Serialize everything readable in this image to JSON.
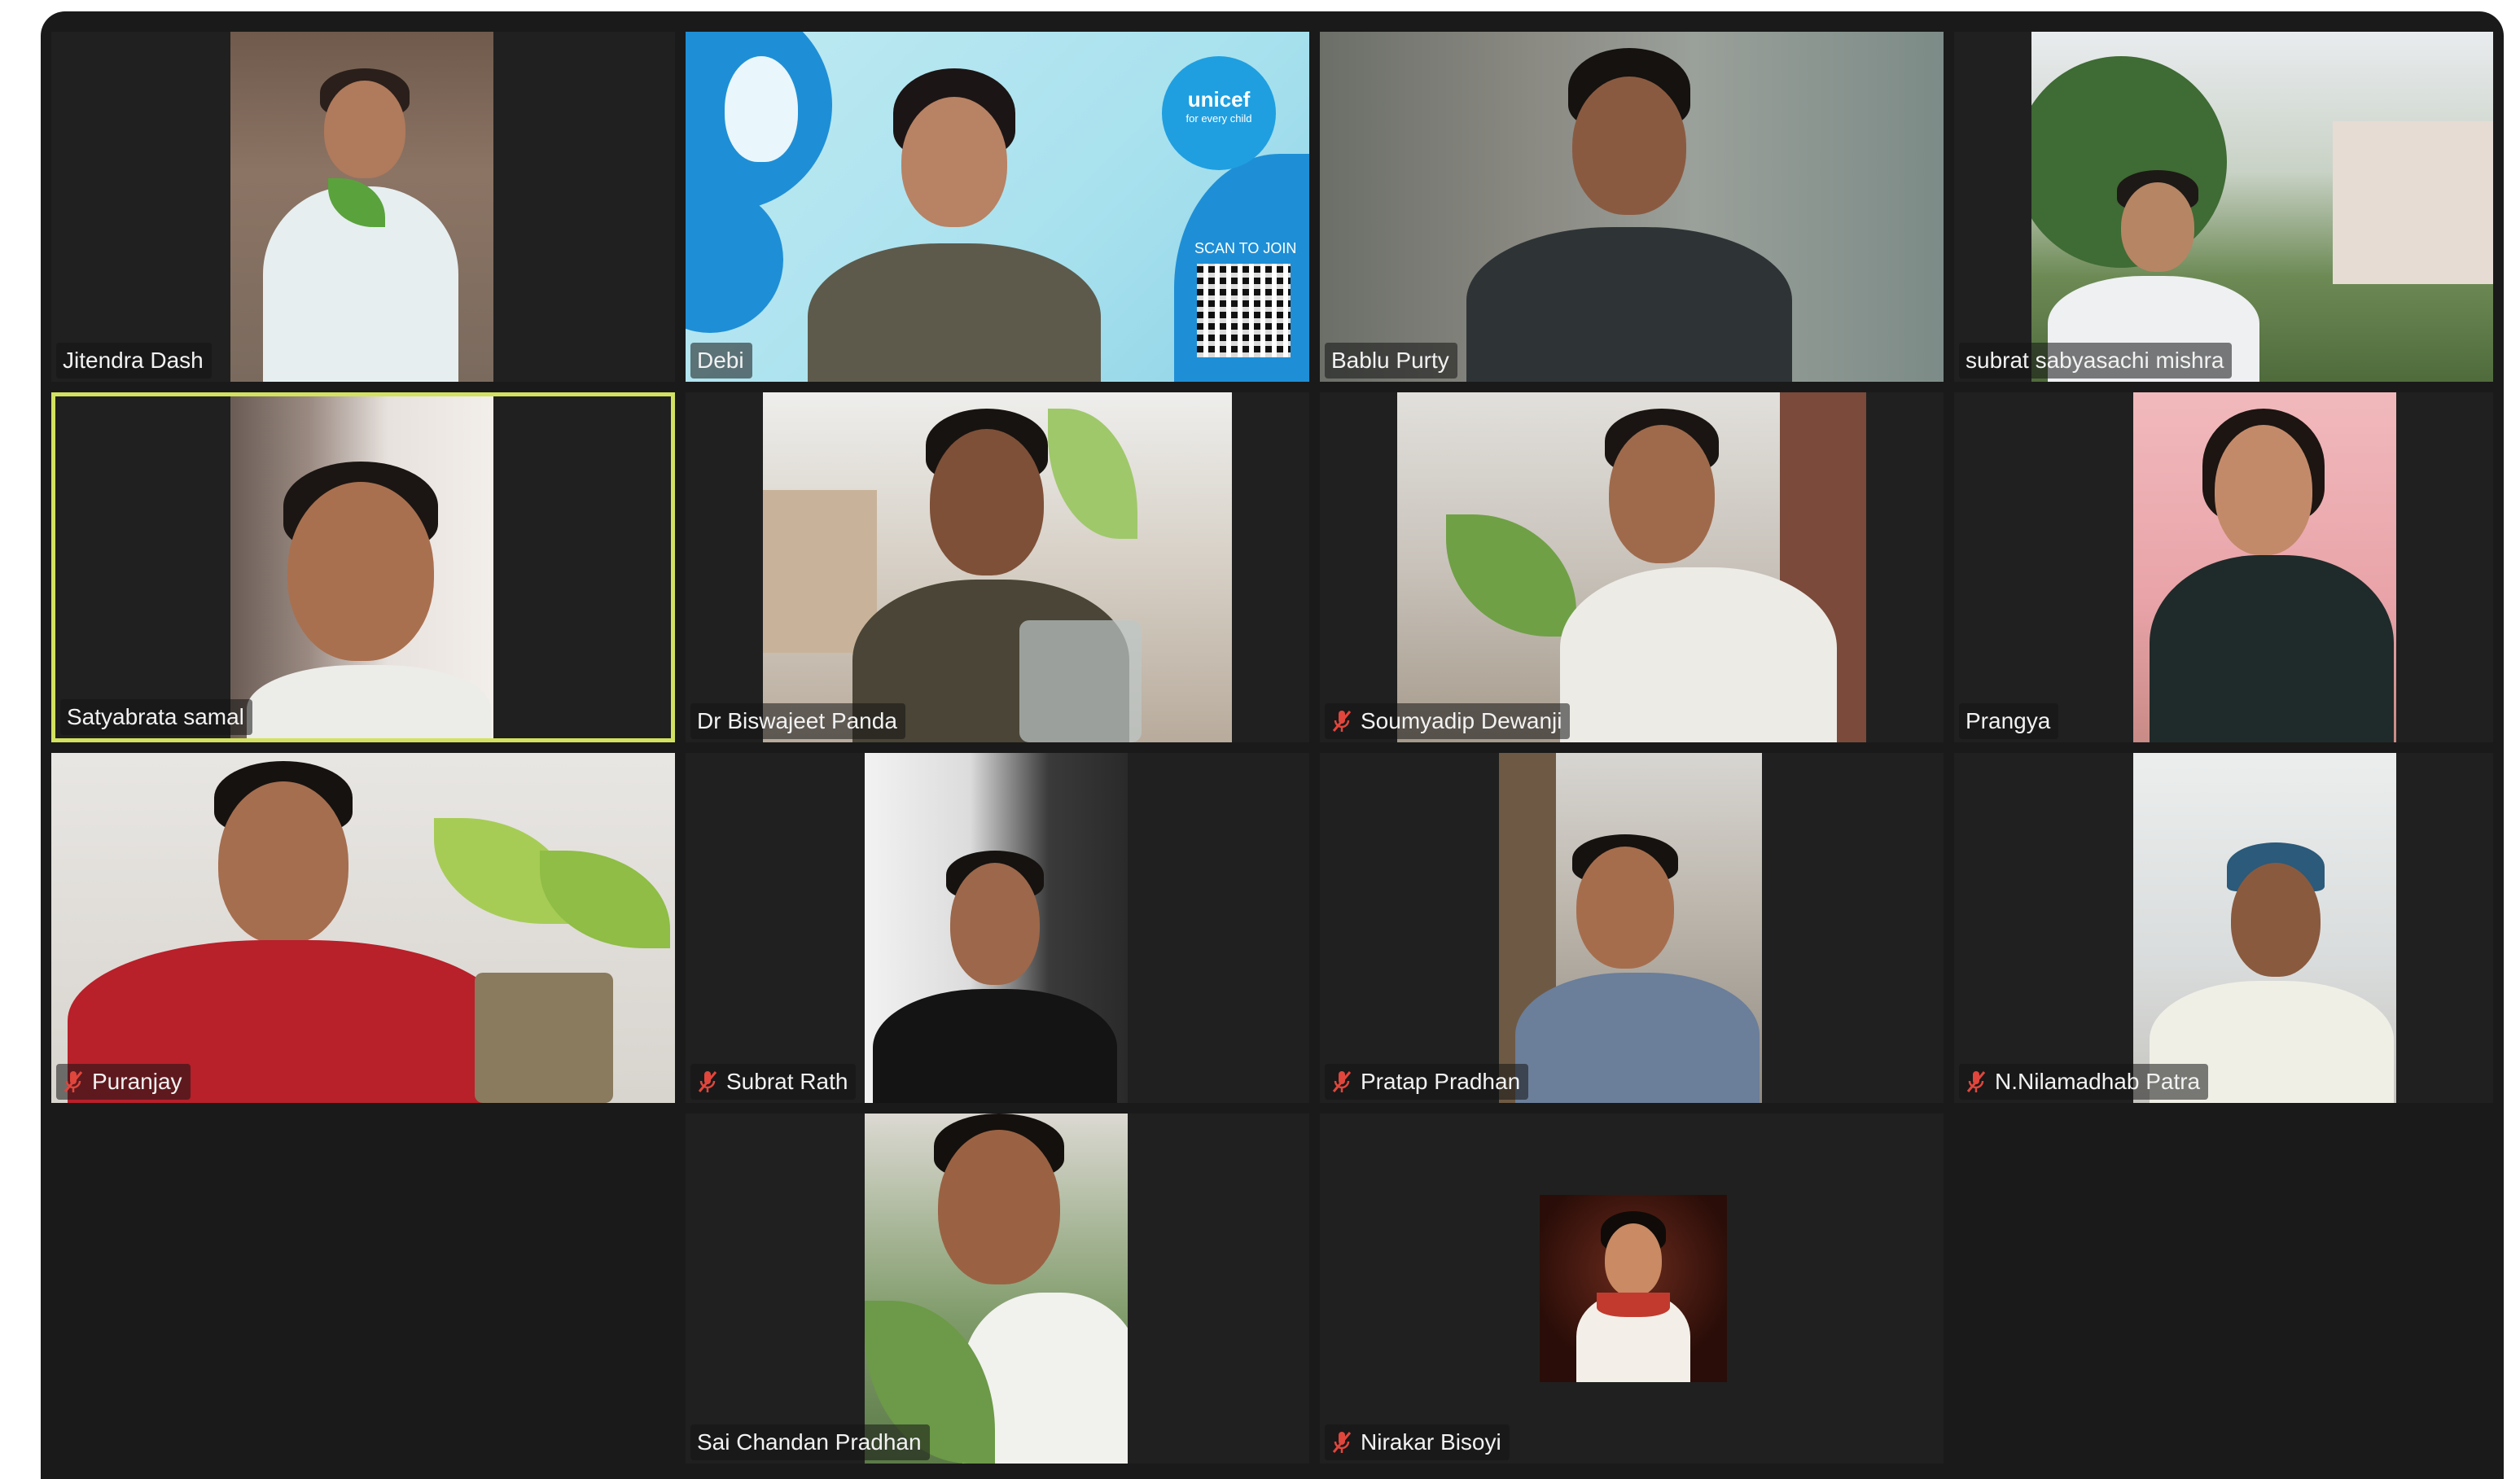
{
  "meeting": {
    "participants": [
      {
        "name": "Jitendra Dash",
        "muted": false,
        "speaking": false
      },
      {
        "name": "Debi",
        "muted": false,
        "speaking": false
      },
      {
        "name": "Bablu Purty",
        "muted": false,
        "speaking": false
      },
      {
        "name": "subrat sabyasachi mishra",
        "muted": false,
        "speaking": false
      },
      {
        "name": "Satyabrata samal",
        "muted": false,
        "speaking": true
      },
      {
        "name": "Dr Biswajeet Panda",
        "muted": false,
        "speaking": false
      },
      {
        "name": "Soumyadip Dewanji",
        "muted": true,
        "speaking": false
      },
      {
        "name": "Prangya",
        "muted": false,
        "speaking": false
      },
      {
        "name": "Puranjay",
        "muted": true,
        "speaking": false
      },
      {
        "name": "Subrat Rath",
        "muted": true,
        "speaking": false
      },
      {
        "name": "Pratap Pradhan",
        "muted": true,
        "speaking": false
      },
      {
        "name": "N.Nilamadhab Patra",
        "muted": true,
        "speaking": false
      },
      {
        "name": "Sai Chandan Pradhan",
        "muted": false,
        "speaking": false
      },
      {
        "name": "Nirakar Bisoyi",
        "muted": true,
        "speaking": false
      }
    ]
  },
  "branding": {
    "unicef_text": "unicef",
    "unicef_tagline": "for every child",
    "scan_text": "SCAN TO JOIN"
  },
  "colors": {
    "window_bg": "#1a1a1a",
    "tile_bg": "#202020",
    "speaking_border": "#d2e260",
    "muted_icon": "#e0463c"
  },
  "icons": {
    "muted": "mic-off-icon"
  }
}
